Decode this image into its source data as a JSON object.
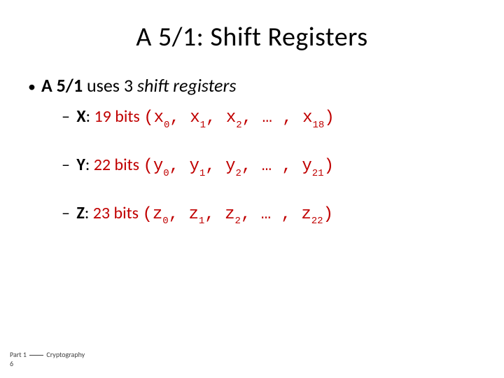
{
  "title": "A 5/1: Shift Registers",
  "main": {
    "bold_prefix": "A 5/1",
    "mid": " uses 3 ",
    "italic_suffix": "shift registers"
  },
  "regs": [
    {
      "name": "X",
      "bits": "19 bits",
      "sym": "x",
      "last": "18"
    },
    {
      "name": "Y",
      "bits": "22 bits",
      "sym": "y",
      "last": "21"
    },
    {
      "name": "Z",
      "bits": "23 bits",
      "sym": "z",
      "last": "22"
    }
  ],
  "footer_part": "Part 1 ",
  "footer_topic": " Cryptography",
  "footer_num": "6"
}
